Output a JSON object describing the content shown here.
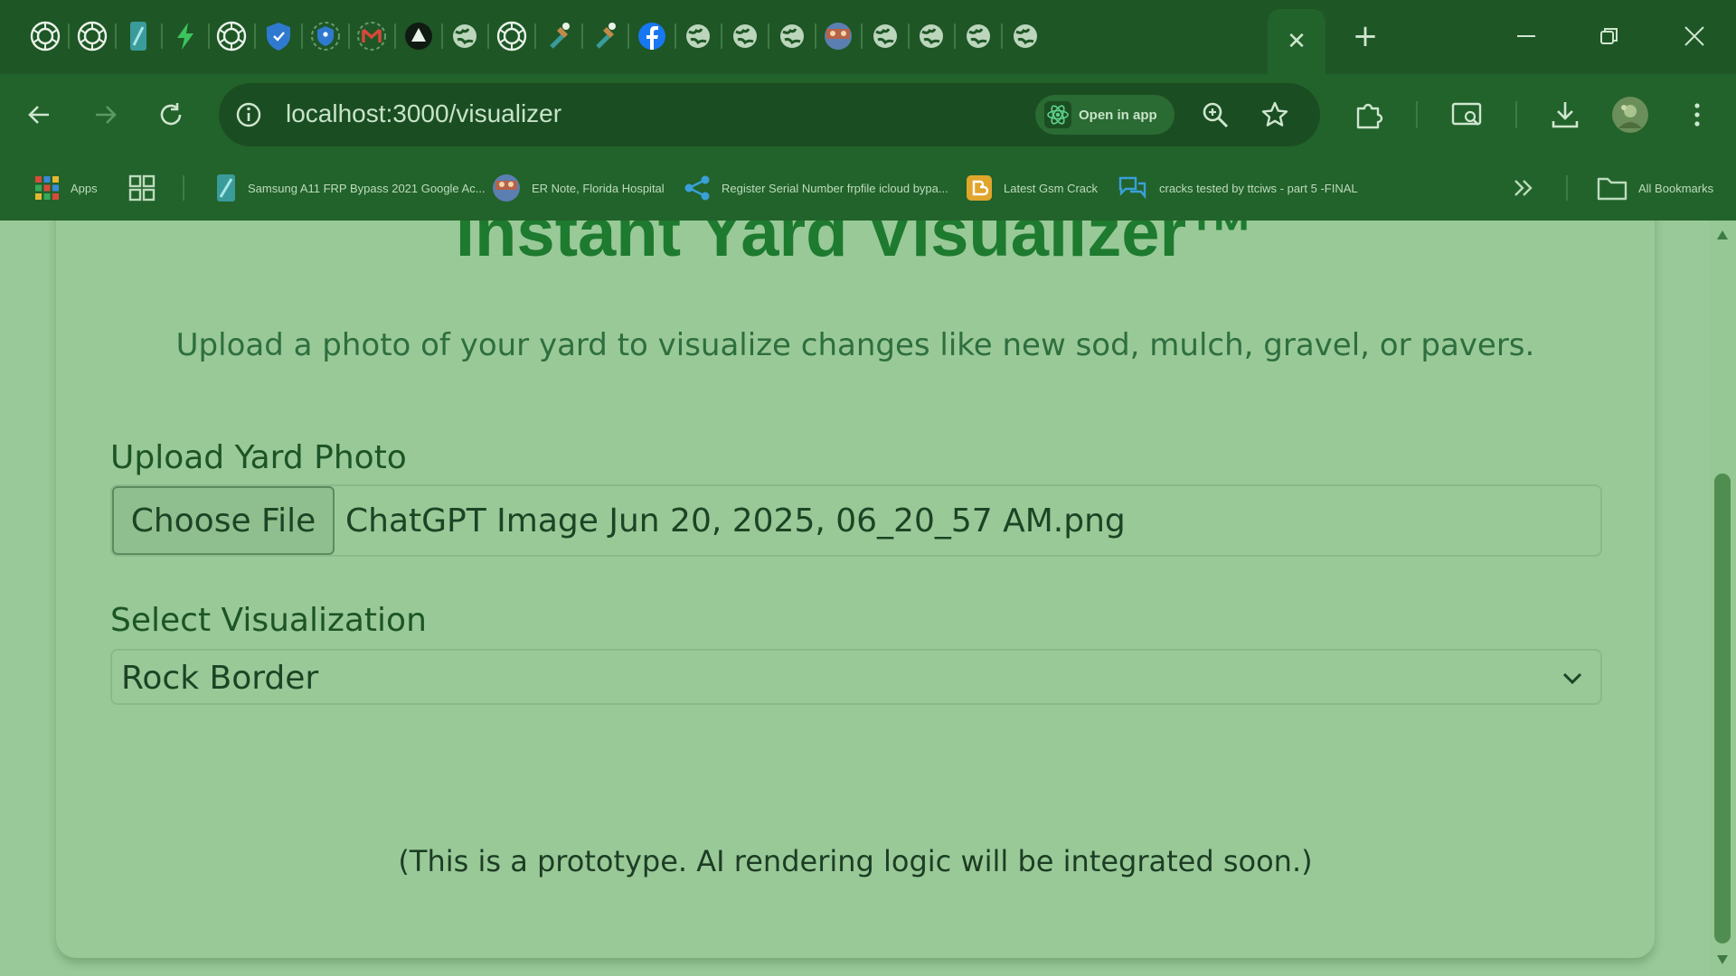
{
  "browser": {
    "tabs": {
      "favicons": [
        "openai-icon",
        "openai-icon",
        "android-frp-icon",
        "bolt-icon",
        "openai-icon",
        "shield-icon",
        "key-shield-icon",
        "gmail-icon",
        "triangle-icon",
        "globe-icon",
        "openai-icon",
        "tool-icon",
        "tool-icon",
        "facebook-icon",
        "globe-icon",
        "globe-icon",
        "globe-icon",
        "hospital-icon",
        "globe-icon",
        "globe-icon",
        "globe-icon",
        "globe-icon"
      ],
      "active_close_label": "✕",
      "new_tab_label": "+"
    },
    "address_bar": {
      "url": "localhost:3000/visualizer",
      "open_in_app_label": "Open in app"
    },
    "bookmarks": {
      "apps_label": "Apps",
      "items": [
        {
          "label": "Samsung A11 FRP Bypass 2021 Google Ac...",
          "icon": "android-frp-icon"
        },
        {
          "label": "ER Note, Florida Hospital",
          "icon": "hospital-icon"
        },
        {
          "label": "Register Serial Number frpfile icloud bypa...",
          "icon": "share-icon"
        },
        {
          "label": "Latest Gsm Crack",
          "icon": "blogger-icon"
        },
        {
          "label": "cracks tested by ttciws - part 5 -FINAL",
          "icon": "chat-icon"
        }
      ],
      "all_bookmarks_label": "All Bookmarks"
    },
    "colors": {
      "tint": "#9ac999",
      "title": "#1d7a2f",
      "frame": "#1e5626"
    }
  },
  "page": {
    "title": "Instant Yard Visualizer™",
    "subtitle": "Upload a photo of your yard to visualize changes like new sod, mulch, gravel, or pavers.",
    "upload": {
      "label": "Upload Yard Photo",
      "button_label": "Choose File",
      "file_name": "ChatGPT Image Jun 20, 2025, 06_20_57 AM.png"
    },
    "visualization": {
      "label": "Select Visualization",
      "selected": "Rock Border"
    },
    "note": "(This is a prototype. AI rendering logic will be integrated soon.)"
  }
}
